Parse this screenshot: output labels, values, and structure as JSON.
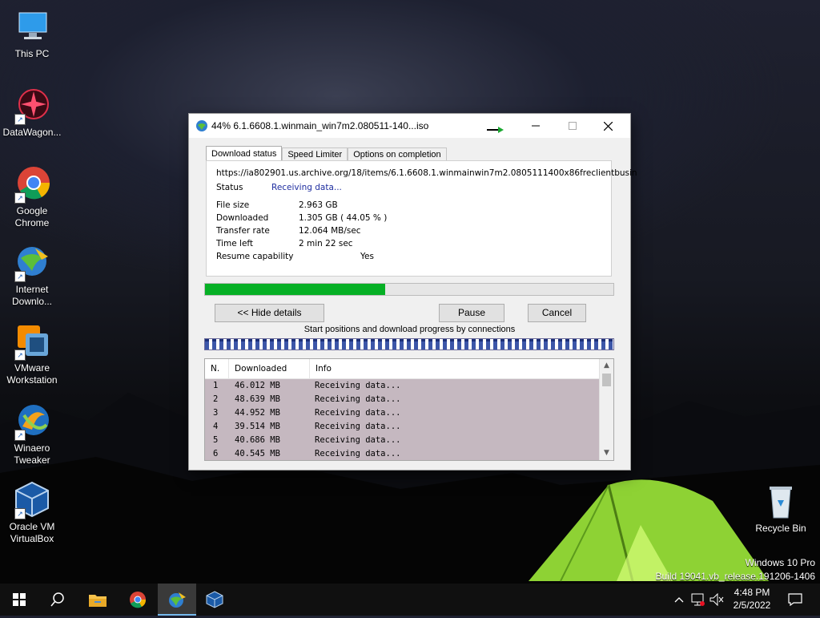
{
  "desktop": {
    "icons": [
      {
        "label": "This PC"
      },
      {
        "label": "DataWagon..."
      },
      {
        "label": "Google Chrome"
      },
      {
        "label": "Internet Downlo..."
      },
      {
        "label": "VMware Workstation"
      },
      {
        "label": "Winaero Tweaker"
      },
      {
        "label": "Oracle VM VirtualBox"
      },
      {
        "label": "Recycle Bin"
      }
    ],
    "watermark": {
      "line1": "Windows 10 Pro",
      "line2": "Build 19041.vb_release.191206-1406"
    }
  },
  "dialog": {
    "title": "44% 6.1.6608.1.winmain_win7m2.080511-140...iso",
    "tabs": [
      {
        "label": "Download status"
      },
      {
        "label": "Speed Limiter"
      },
      {
        "label": "Options on completion"
      }
    ],
    "url": "https://ia802901.us.archive.org/18/items/6.1.6608.1.winmainwin7m2.0805111400x86freclientbusin",
    "status": {
      "label": "Status",
      "value": "Receiving data..."
    },
    "info": [
      {
        "label": "File size",
        "value": "2.963  GB"
      },
      {
        "label": "Downloaded",
        "value": "1.305  GB  ( 44.05 % )"
      },
      {
        "label": "Transfer rate",
        "value": "12.064  MB/sec"
      },
      {
        "label": "Time left",
        "value": "2 min 22 sec"
      },
      {
        "label": "Resume capability",
        "value": "Yes"
      }
    ],
    "progress_percent": 44.05,
    "buttons": {
      "hide_details": "<< Hide details",
      "pause": "Pause",
      "cancel": "Cancel"
    },
    "connections_label": "Start positions and download progress by connections",
    "table": {
      "headers": [
        "N.",
        "Downloaded",
        "Info"
      ],
      "rows": [
        [
          "1",
          "46.012  MB",
          "Receiving data..."
        ],
        [
          "2",
          "48.639  MB",
          "Receiving data..."
        ],
        [
          "3",
          "44.952  MB",
          "Receiving data..."
        ],
        [
          "4",
          "39.514  MB",
          "Receiving data..."
        ],
        [
          "5",
          "40.686  MB",
          "Receiving data..."
        ],
        [
          "6",
          "40.545  MB",
          "Receiving data..."
        ]
      ]
    },
    "colors": {
      "progress": "#06b025",
      "status_text": "#1f2ea0",
      "selection": "#c5b8c0"
    }
  },
  "taskbar": {
    "time": "4:48 PM",
    "date": "2/5/2022",
    "icons": [
      "windows-start-icon",
      "search-icon",
      "file-explorer-icon",
      "chrome-icon",
      "idm-icon",
      "virtualbox-icon"
    ]
  }
}
